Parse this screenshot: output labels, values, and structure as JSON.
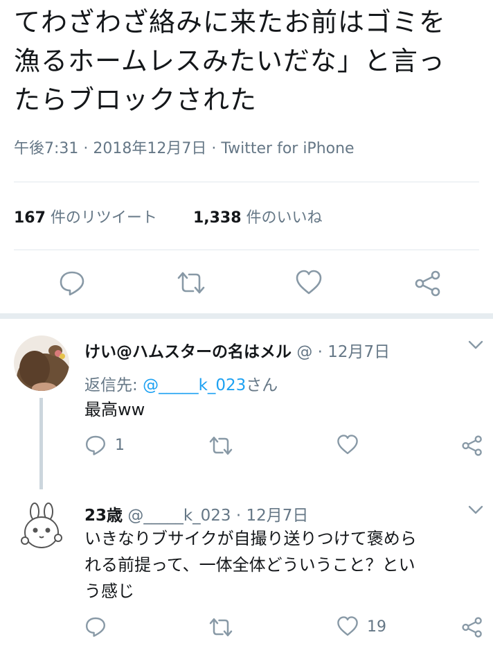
{
  "tweet": {
    "text_lines": [
      "てわざわざ絡みに来たお前はゴミを",
      "漁るホームレスみたいだな」と言っ",
      "たらブロックされた"
    ],
    "meta": "午後7:31 · 2018年12月7日 · Twitter for iPhone",
    "retweet_count": "167",
    "retweet_label": " 件のリツイート",
    "like_count": "1,338",
    "like_label": " 件のいいね"
  },
  "icons": {
    "reply": "reply-icon",
    "retweet": "retweet-icon",
    "like": "heart-icon",
    "share": "share-icon",
    "menu": "chevron-down-icon"
  },
  "replies": [
    {
      "name": "けい@ハムスターの名はメル",
      "handle": "@",
      "date": "· 12月7日",
      "reply_to_prefix": "返信先: ",
      "reply_to_handle": "@_____k_023",
      "reply_to_suffix": "さん",
      "text_lines": [
        "最高ww"
      ],
      "reply_count": "1",
      "like_count": ""
    },
    {
      "name": "23歳",
      "handle": "@_____k_023",
      "date": "· 12月7日",
      "text_lines": [
        "いきなりブサイクが自撮り送りつけて褒めら",
        "れる前提って、一体全体どういうこと？とい",
        "う感じ"
      ],
      "reply_count": "",
      "like_count": "19"
    }
  ],
  "colors": {
    "text": "#14171a",
    "secondary": "#657786",
    "icon": "#8899a6",
    "link": "#1da1f2",
    "divider": "#e1e8ed"
  }
}
